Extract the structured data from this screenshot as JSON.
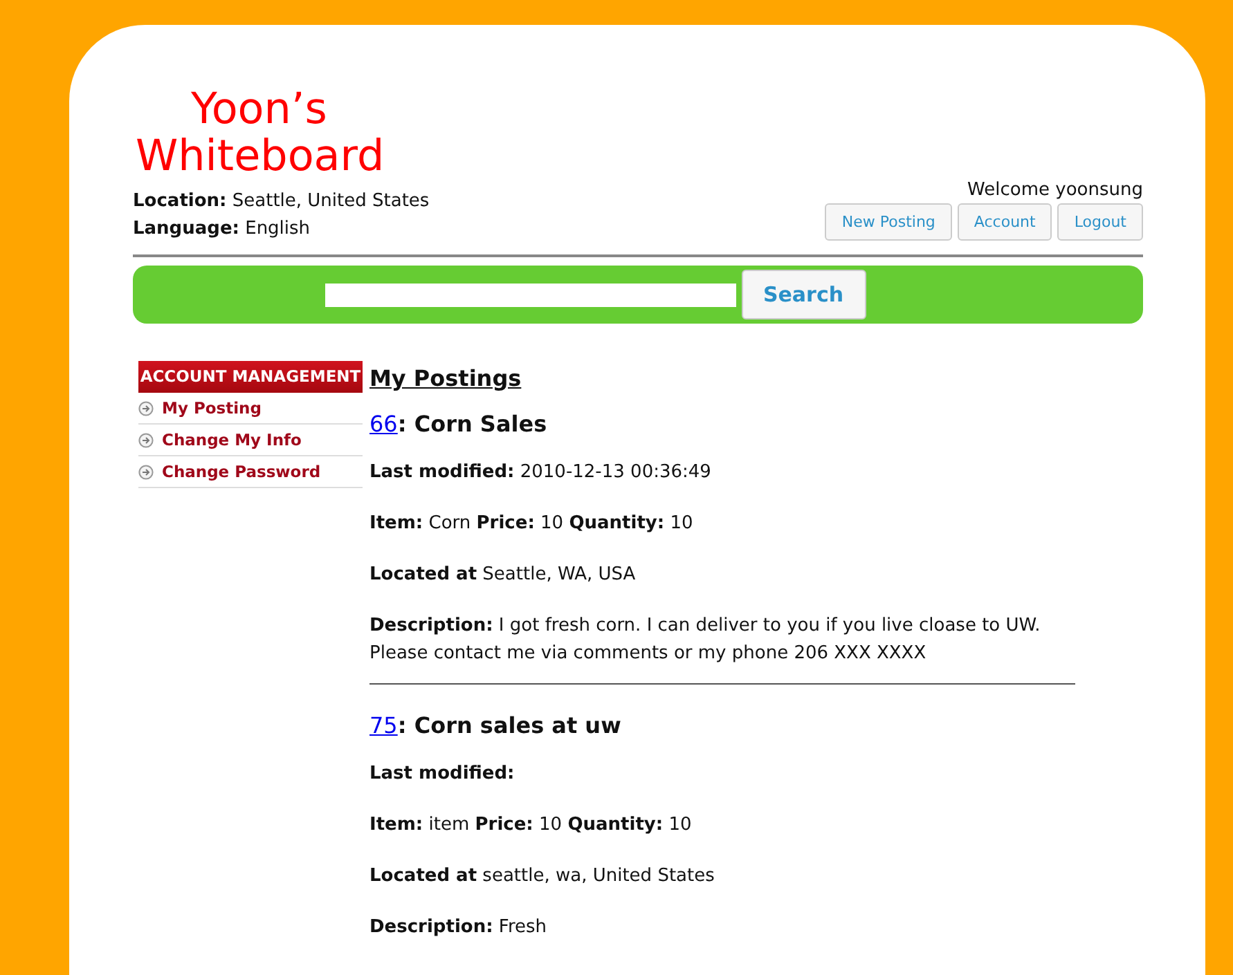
{
  "logo": {
    "lines": [
      "Yoon’s",
      "Whiteboard"
    ]
  },
  "info": [
    {
      "label": "Location:",
      "value": "Seattle, United States"
    },
    {
      "label": "Language:",
      "value": "English"
    }
  ],
  "welcome": "Welcome yoonsung",
  "header_buttons": [
    "New Posting",
    "Account",
    "Logout"
  ],
  "search": {
    "button": "Search"
  },
  "sidebar": {
    "title": "ACCOUNT MANAGEMENT",
    "items": [
      {
        "label": "My Posting"
      },
      {
        "label": "Change My Info"
      },
      {
        "label": "Change Password"
      }
    ]
  },
  "main": {
    "heading": "My Postings",
    "postings": [
      {
        "id": "66",
        "title": ": Corn Sales",
        "lines": [
          "**Last modified:** 2010-12-13 00:36:49",
          "**Item:** Corn **Price:** 10 **Quantity:** 10",
          "**Located at** Seattle, WA, USA",
          "**Description:** I got fresh corn. I can deliver to you if you live cloase to UW. Please contact me via comments or my phone 206 XXX XXXX"
        ]
      },
      {
        "id": "75",
        "title": ": Corn sales at uw",
        "lines": [
          "**Last modified:**",
          "**Item:** item **Price:** 10 **Quantity:** 10",
          "**Located at** seattle, wa, United States",
          "**Description:** Fresh"
        ]
      }
    ]
  }
}
